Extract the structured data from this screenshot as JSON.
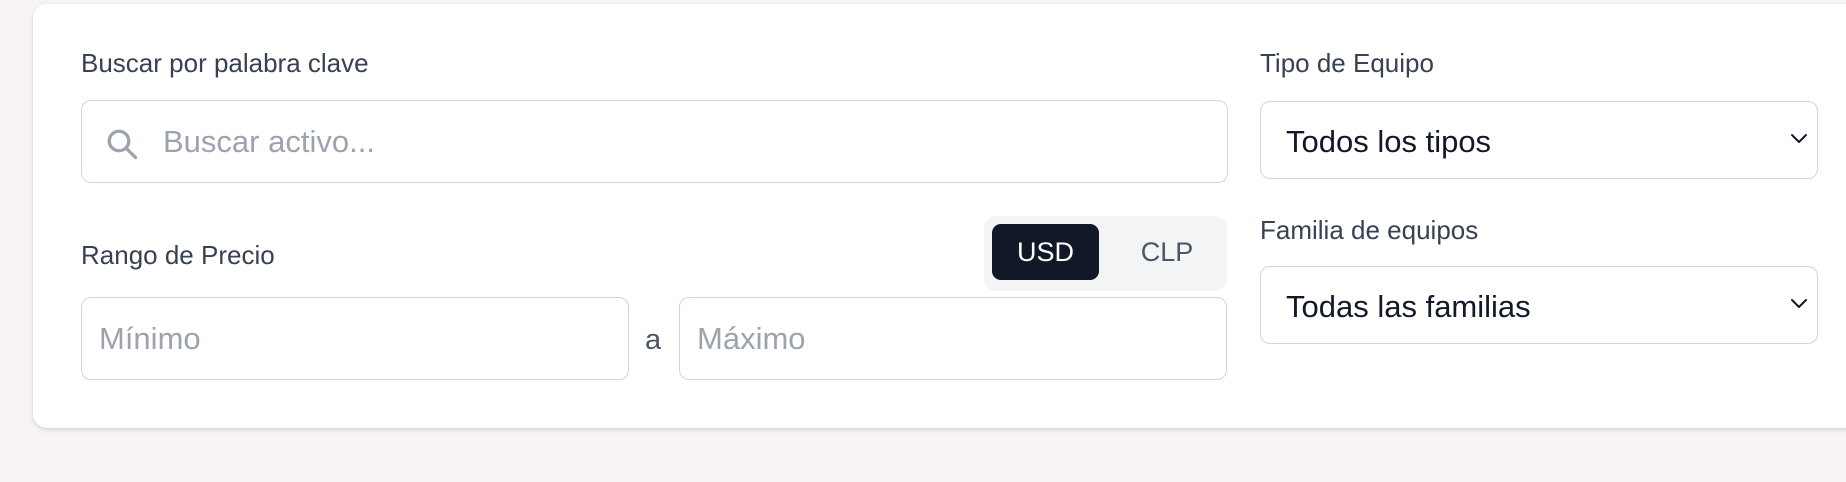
{
  "search": {
    "label": "Buscar por palabra clave",
    "placeholder": "Buscar activo...",
    "value": "",
    "icon": "search-icon"
  },
  "price_range": {
    "label": "Rango de Precio",
    "min_placeholder": "Mínimo",
    "max_placeholder": "Máximo",
    "separator": "a",
    "currency_options": [
      "USD",
      "CLP"
    ],
    "currency_selected": "USD"
  },
  "equipment_type": {
    "label": "Tipo de Equipo",
    "selected": "Todos los tipos"
  },
  "equipment_family": {
    "label": "Familia de equipos",
    "selected": "Todas las familias"
  },
  "colors": {
    "accent": "#111827",
    "border": "#d1d5db",
    "background": "#f8f4f3"
  }
}
